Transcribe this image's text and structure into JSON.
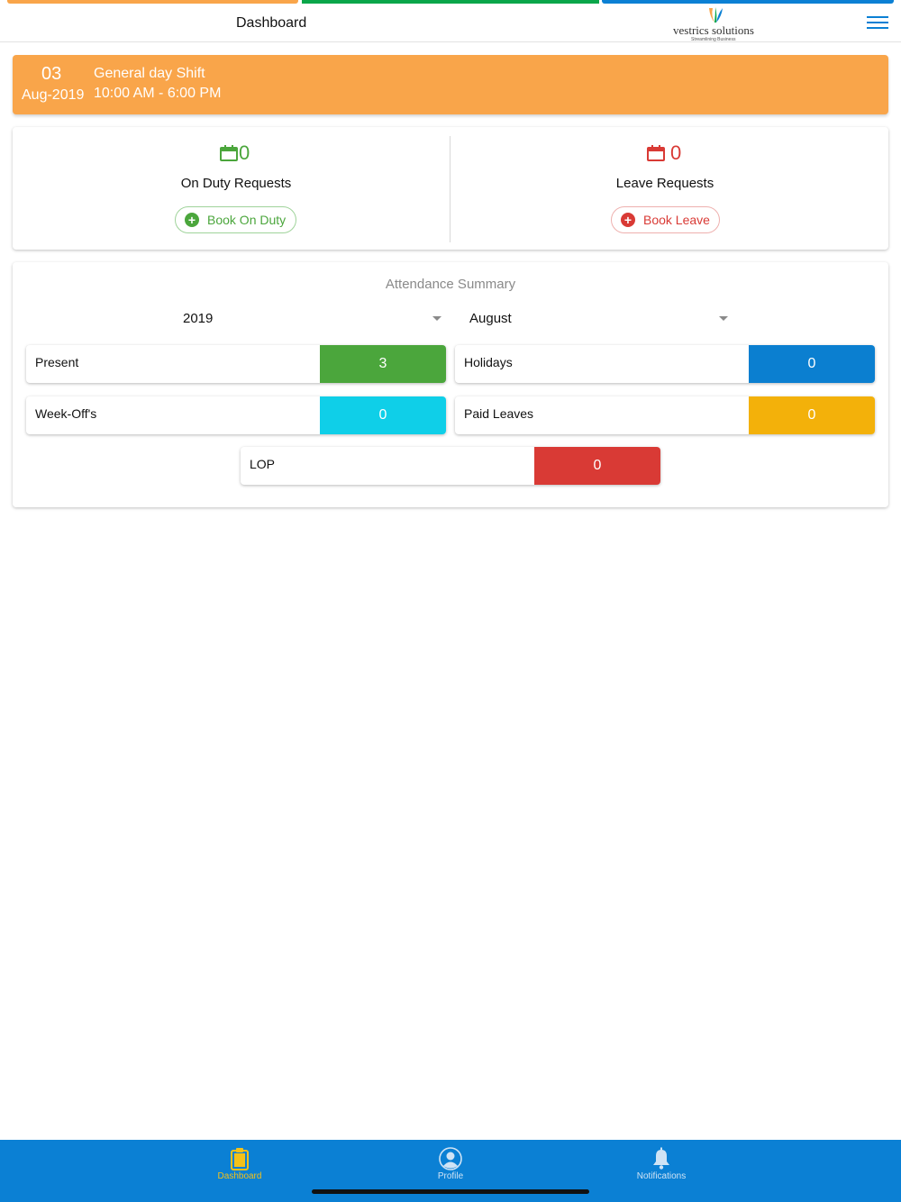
{
  "colors": {
    "stripe_orange": "#f9a54a",
    "stripe_green": "#0aa64a",
    "stripe_blue": "#0b80d4",
    "shift_bg": "#f9a54a",
    "green": "#4ba63c",
    "red": "#d93a35",
    "present": "#4ba63c",
    "holidays": "#0b7fd0",
    "weekoffs": "#0fcfe8",
    "paid_leaves": "#f3b10a",
    "lop": "#d93a35",
    "tabbar": "#0b80d4",
    "tab_active": "#f3c11a",
    "tab_inactive": "#cfe3f5"
  },
  "header": {
    "title": "Dashboard",
    "logo_text": "vestrics solutions",
    "logo_tagline": "Streamlining Business",
    "menu_icon": "hamburger-menu-icon"
  },
  "shift": {
    "day": "03",
    "month_year": "Aug-2019",
    "name": "General day Shift",
    "time": "10:00 AM - 6:00 PM"
  },
  "requests": {
    "on_duty": {
      "icon": "calendar-icon",
      "count": "0",
      "label": "On Duty Requests",
      "button_label": "Book On Duty",
      "button_icon": "plus-circle-icon"
    },
    "leave": {
      "icon": "calendar-icon",
      "count": "0",
      "label": "Leave Requests",
      "button_label": "Book Leave",
      "button_icon": "plus-circle-icon"
    }
  },
  "attendance": {
    "title": "Attendance Summary",
    "year": "2019",
    "month": "August",
    "stats": {
      "present": {
        "label": "Present",
        "value": "3"
      },
      "holidays": {
        "label": "Holidays",
        "value": "0"
      },
      "weekoffs": {
        "label": "Week-Off's",
        "value": "0"
      },
      "paid_leaves": {
        "label": "Paid Leaves",
        "value": "0"
      },
      "lop": {
        "label": "LOP",
        "value": "0"
      }
    }
  },
  "tabs": [
    {
      "label": "Dashboard",
      "icon": "clipboard-icon",
      "active": true
    },
    {
      "label": "Profile",
      "icon": "user-circle-icon",
      "active": false
    },
    {
      "label": "Notifications",
      "icon": "bell-icon",
      "active": false
    }
  ]
}
